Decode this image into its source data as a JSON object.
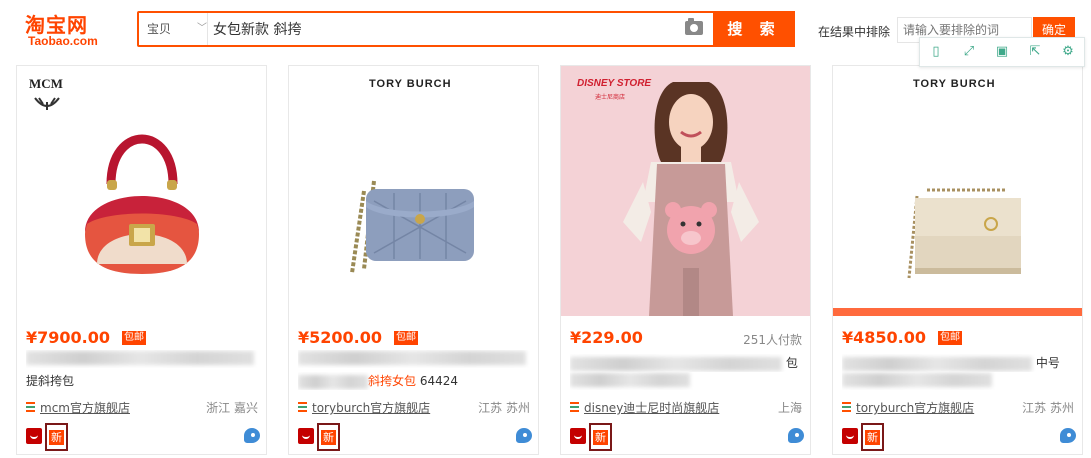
{
  "header": {
    "logo_cn": "淘宝网",
    "logo_en": "Taobao.com",
    "search_category": "宝贝",
    "search_value": "女包新款 斜挎",
    "search_button": "搜 索",
    "exclude_label": "在结果中排除",
    "exclude_placeholder": "请输入要排除的词",
    "exclude_button": "确定"
  },
  "toolbar": {
    "icons": [
      "phone-frame-icon",
      "fullscreen-icon",
      "save-icon",
      "share-icon",
      "settings-icon"
    ]
  },
  "products": [
    {
      "brand": "MCM",
      "price": "¥7900.00",
      "free_shipping": "包邮",
      "paid_count": "",
      "title_tail": "提斜挎包",
      "shop": "mcm官方旗舰店",
      "location": "浙江 嘉兴",
      "new_badge": "新"
    },
    {
      "brand": "TORY BURCH",
      "price": "¥5200.00",
      "free_shipping": "包邮",
      "paid_count": "",
      "title_kw": "斜挎女包",
      "title_num": "64424",
      "shop": "toryburch官方旗舰店",
      "location": "江苏 苏州",
      "new_badge": "新"
    },
    {
      "brand": "DISNEY STORE",
      "brand_sub": "迪士尼商店",
      "price": "¥229.00",
      "free_shipping": "",
      "paid_count": "251人付款",
      "title_tail": "包",
      "shop": "disney迪士尼时尚旗舰店",
      "location": "上海",
      "new_badge": "新"
    },
    {
      "brand": "TORY BURCH",
      "price": "¥4850.00",
      "free_shipping": "包邮",
      "paid_count": "",
      "title_tail": "中号",
      "shop": "toryburch官方旗舰店",
      "location": "江苏 苏州",
      "new_badge": "新"
    }
  ],
  "colors": {
    "accent": "#ff5000",
    "price": "#ff4400",
    "toolbar_icon": "#3fa98a"
  }
}
